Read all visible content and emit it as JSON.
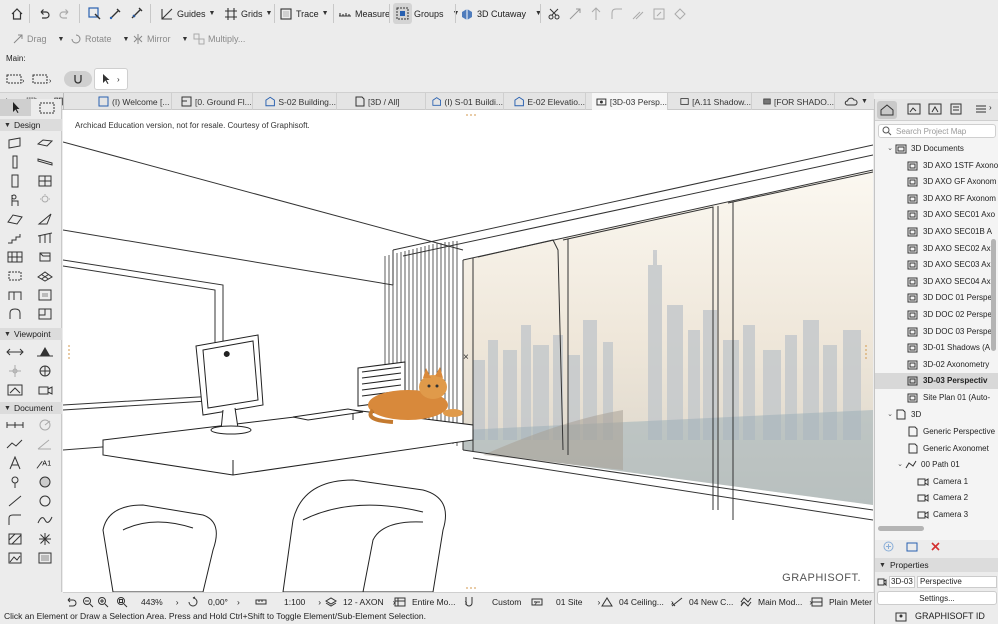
{
  "toolbar": {
    "guides": "Guides",
    "grids": "Grids",
    "trace": "Trace",
    "measure": "Measure",
    "groups": "Groups",
    "cutaway": "3D Cutaway"
  },
  "edit_toolbar": {
    "drag": "Drag",
    "rotate": "Rotate",
    "mirror": "Mirror",
    "multiply": "Multiply..."
  },
  "infobox": {
    "label": "Main:"
  },
  "tabs": [
    "(I) Welcome [...",
    "[0. Ground Fl...",
    "S-02 Building...",
    "[3D / All]",
    "(I) S-01 Buildi...",
    "E-02 Elevatio...",
    "[3D-03 Persp...",
    "[A.11 Shadow...",
    "[FOR SHADO..."
  ],
  "toolbox": {
    "design": "Design",
    "viewpoint": "Viewpoint",
    "document": "Document"
  },
  "viewport": {
    "note": "Archicad Education version, not for resale. Courtesy of Graphisoft.",
    "brand": "GRAPHISOFT."
  },
  "navigator": {
    "search_placeholder": "Search Project Map",
    "folder_3d_documents": "3D Documents",
    "items": [
      "3D AXO 1STF Axono",
      "3D AXO GF Axonom",
      "3D AXO RF Axonom",
      "3D AXO SEC01 Axo",
      "3D AXO SEC01B A",
      "3D AXO SEC02 Ax",
      "3D AXO SEC03 Ax",
      "3D AXO SEC04 Ax",
      "3D DOC 01 Perspe",
      "3D DOC 02 Perspe",
      "3D DOC 03 Perspe",
      "3D-01 Shadows (A",
      "3D-02 Axonometry",
      "3D-03 Perspectiv",
      "Site Plan 01 (Auto-"
    ],
    "selected_item": "3D-03 Perspectiv",
    "folder_3d": "3D",
    "generic_perspective": "Generic Perspective",
    "generic_axonometry": "Generic Axonomet",
    "path": "00 Path 01",
    "cameras": [
      "Camera 1",
      "Camera 2",
      "Camera 3"
    ]
  },
  "properties": {
    "header": "Properties",
    "id": "3D-03",
    "name": "Perspective",
    "settings": "Settings...",
    "graphisoft_id": "GRAPHISOFT ID"
  },
  "viewbar": {
    "zoom": "443%",
    "angle": "0,00°",
    "scale": "1:100",
    "layer_combo": "12 - AXON",
    "model_view": "Entire Mo...",
    "pen_set": "Custom",
    "mvo": "01 Site",
    "partial_structure": "04 Ceiling...",
    "dimension": "04 New C...",
    "renovation": "Main Mod...",
    "surface": "Plain Meter"
  },
  "status": "Click an Element or Draw a Selection Area. Press and Hold Ctrl+Shift to Toggle Element/Sub-Element Selection."
}
